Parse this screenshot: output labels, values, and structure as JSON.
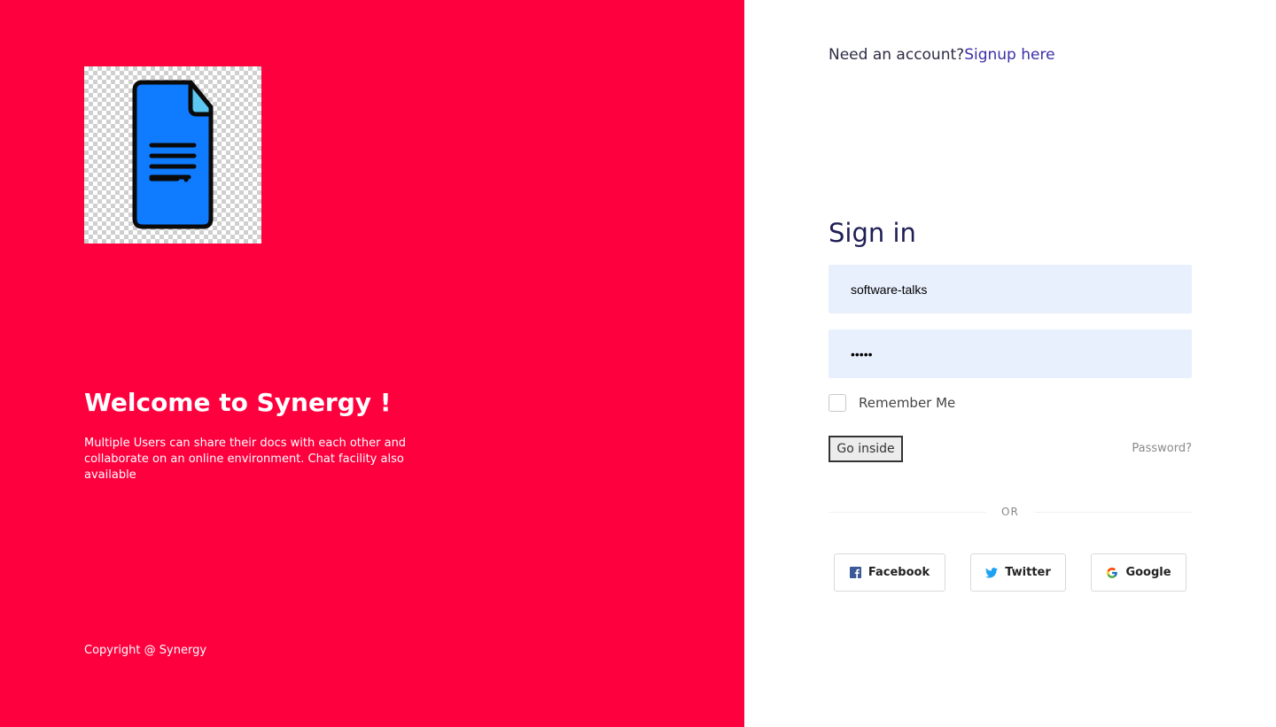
{
  "colors": {
    "brand_red": "#ff003f",
    "input_bg": "#e8effd",
    "link_blue": "#3a2fa8",
    "facebook": "#3b5998",
    "twitter": "#1da1f2"
  },
  "left": {
    "logo_icon": "document-icon",
    "welcome_title": "Welcome to Synergy !",
    "description": "Multiple Users can share their docs with each other and collaborate on an online environment. Chat facility also available",
    "copyright": "Copyright @ Synergy"
  },
  "right": {
    "need_account_text": "Need an account?",
    "signup_link": "Signup here",
    "title": "Sign in",
    "username_value": "software-talks",
    "password_value": "•••••",
    "remember_label": "Remember Me",
    "submit_label": "Go inside",
    "forgot_label": "Password?",
    "or_label": "OR",
    "social": {
      "facebook": "Facebook",
      "twitter": "Twitter",
      "google": "Google"
    }
  }
}
